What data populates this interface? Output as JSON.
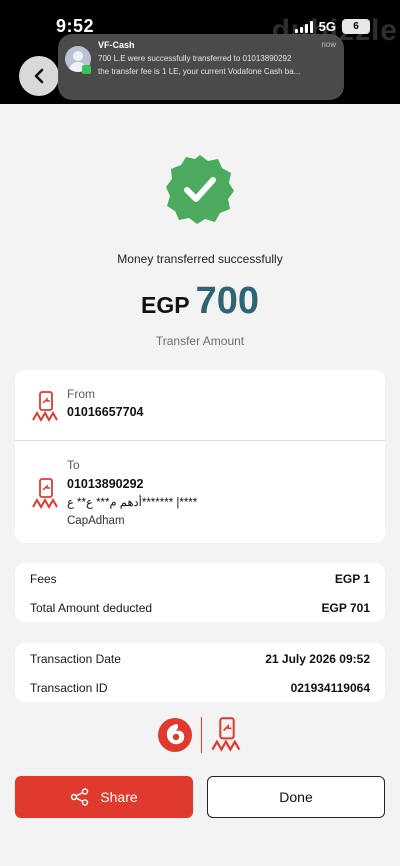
{
  "status_bar": {
    "time": "9:52",
    "network": "5G",
    "battery": "6",
    "watermark": "dubizzle"
  },
  "notification": {
    "app": "VF-Cash",
    "time": "now",
    "line1": "700 L.E were successfully transferred to 01013890292",
    "line2": "the transfer fee is 1 LE, your current Vodafone Cash ba..."
  },
  "header": {
    "back_icon": "chevron-left-icon"
  },
  "success": {
    "icon": "check-badge-icon",
    "message": "Money transferred successfully",
    "currency": "EGP",
    "amount": "700",
    "amount_label": "Transfer Amount",
    "badge_color": "#4caa5f"
  },
  "from": {
    "label": "From",
    "number": "01016657704",
    "icon": "wallet-logo-icon"
  },
  "to": {
    "label": "To",
    "number": "01013890292",
    "name": "أدهم م*** ع** ع******* |****",
    "nickname": "CapAdham",
    "icon": "wallet-logo-icon"
  },
  "fees": {
    "fees_label": "Fees",
    "fees_value": "EGP 1",
    "total_label": "Total Amount deducted",
    "total_value": "EGP 701"
  },
  "transaction": {
    "date_label": "Transaction Date",
    "date_value": "21 July 2026 09:52",
    "id_label": "Transaction ID",
    "id_value": "021934119064"
  },
  "brand": {
    "vodafone_icon": "vodafone-logo-icon",
    "cash_icon": "vodafone-cash-logo-icon",
    "color": "#e03a2f"
  },
  "actions": {
    "share_label": "Share",
    "share_icon": "share-icon",
    "done_label": "Done"
  }
}
